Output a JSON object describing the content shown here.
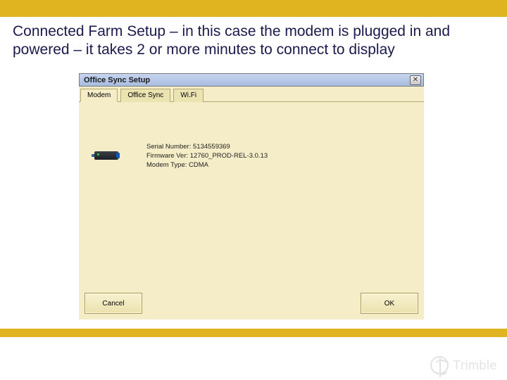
{
  "slide": {
    "title": "Connected Farm Setup – in this case the modem is plugged in and powered – it takes 2 or more minutes to connect to display"
  },
  "dialog": {
    "title": "Office Sync Setup",
    "tabs": [
      {
        "label": "Modem"
      },
      {
        "label": "Office Sync"
      },
      {
        "label": "Wi.Fi"
      }
    ],
    "info": {
      "serial_label": "Serial Number:",
      "serial_value": "5134559369",
      "firmware_label": "Firmware Ver:",
      "firmware_value": "12760_PROD-REL-3.0.13",
      "modem_type_label": "Modem Type:",
      "modem_type_value": "CDMA"
    },
    "buttons": {
      "cancel": "Cancel",
      "ok": "OK"
    }
  },
  "brand": {
    "name": "Trimble"
  }
}
